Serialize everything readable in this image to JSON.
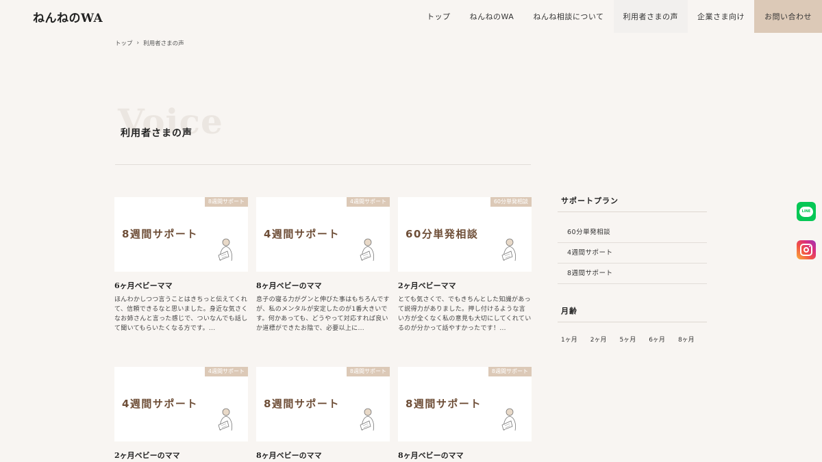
{
  "header": {
    "logo": "ねんねのWA",
    "nav": [
      {
        "label": "トップ"
      },
      {
        "label": "ねんねのWA"
      },
      {
        "label": "ねんね相談について"
      },
      {
        "label": "利用者さまの声"
      },
      {
        "label": "企業さま向け"
      },
      {
        "label": "お問い合わせ"
      }
    ]
  },
  "breadcrumb": {
    "home": "トップ",
    "separator": "›",
    "current": "利用者さまの声"
  },
  "hero": {
    "bg_word": "Voice",
    "title": "利用者さまの声"
  },
  "cards": [
    {
      "tag": "8週間サポート",
      "thumb_text": "8週間サポート",
      "title": "6ヶ月ベビーママ",
      "excerpt": "ほんわかしつつ言うことはきちっと伝えてくれて、信頼できるなと思いました。身近な気さくなお姉さんと言った感じで、ついなんでも話して聞いてもらいたくなる方です。..."
    },
    {
      "tag": "4週間サポート",
      "thumb_text": "4週間サポート",
      "title": "8ヶ月ベビーのママ",
      "excerpt": "息子の寝る力がグンと伸びた事はもちろんですが、私のメンタルが安定したのが1番大きいです。何かあっても、どうやって対応すれば良いか道標ができたお陰で、必要以上に..."
    },
    {
      "tag": "60分単発相談",
      "thumb_text": "60分単発相談",
      "title": "2ヶ月ベビーママ",
      "excerpt": "とても気さくで、でもきちんとした知識があって説得力がありました。押し付けるような言い方が全くなく私の意見も大切にしてくれているのが分かって話やすかったです！..."
    },
    {
      "tag": "4週間サポート",
      "thumb_text": "4週間サポート",
      "title": "2ヶ月ベビーのママ",
      "excerpt": ""
    },
    {
      "tag": "8週間サポート",
      "thumb_text": "8週間サポート",
      "title": "8ヶ月ベビーのママ",
      "excerpt": ""
    },
    {
      "tag": "8週間サポート",
      "thumb_text": "8週間サポート",
      "title": "8ヶ月ベビーのママ",
      "excerpt": ""
    }
  ],
  "sidebar": {
    "plans_heading": "サポートプラン",
    "plans": [
      "60分単発相談",
      "4週間サポート",
      "8週間サポート"
    ],
    "age_heading": "月齢",
    "ages": [
      "1ヶ月",
      "2ヶ月",
      "5ヶ月",
      "6ヶ月",
      "8ヶ月"
    ]
  },
  "social": {
    "line_label": "LINE"
  },
  "colors": {
    "background": "#f8f5f2",
    "accent": "#dcc9b7",
    "thumb_text": "#6e4e37",
    "line": "#06c755"
  }
}
